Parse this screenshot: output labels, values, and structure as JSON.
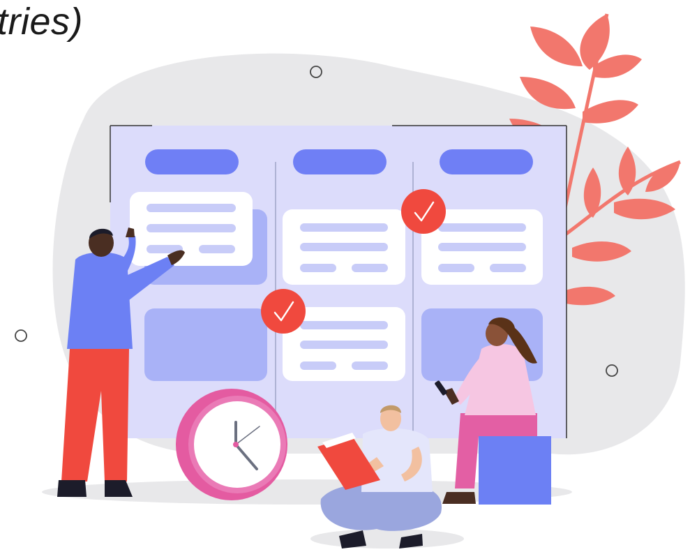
{
  "heading": {
    "text": "tries)"
  },
  "illustration": {
    "subject": "task-board-teamwork",
    "icons": [
      "check-icon",
      "clock-icon",
      "book-icon",
      "phone-icon",
      "leaf-icon"
    ]
  },
  "colors": {
    "board": "#dcdcfb",
    "column_header": "#6f7ff5",
    "card_white": "#ffffff",
    "card_placeholder": "#a9b2f7",
    "line_lavender": "#c8ccf8",
    "check_badge": "#f0493e",
    "plant": "#f2776d",
    "blob": "#e8e8ea",
    "clock_ring": "#e45ba1",
    "shirt_blue": "#6c80f4",
    "pants_red": "#f0493e",
    "pants_pink": "#e35fa4",
    "seat_cube": "#6c80f4",
    "reader_pants": "#9aa6de"
  }
}
